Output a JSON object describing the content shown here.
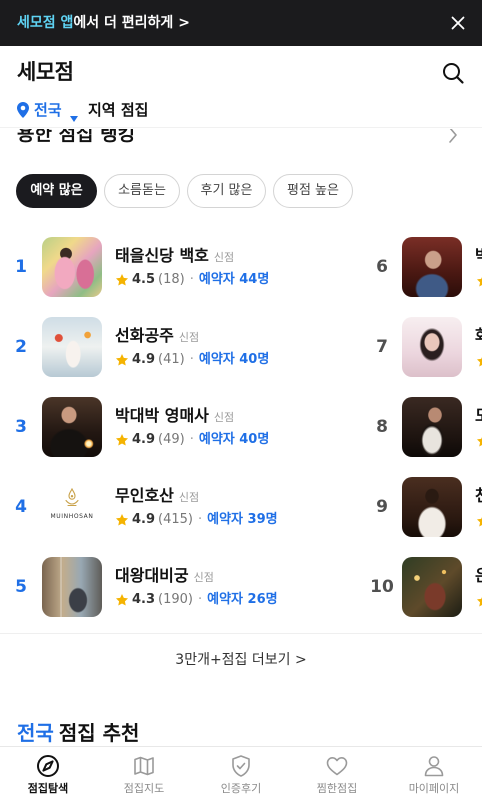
{
  "colors": {
    "accent": "#1f6fe6",
    "star": "#f5b301",
    "banner_bg": "#1b1b1d",
    "banner_highlight": "#5fd3f3",
    "rank_secondary": "#505050",
    "chip_selected_bg": "#1b1b1f"
  },
  "banner": {
    "highlight": "세모점 앱",
    "text": "에서 더 편리하게 >",
    "close_icon": "close-icon"
  },
  "header": {
    "title": "세모점",
    "search_icon": "search-icon"
  },
  "location": {
    "pin_icon": "location-pin-icon",
    "region": "전국",
    "dropdown_icon": "dropdown-triangle-icon",
    "suffix": "지역 점집"
  },
  "ranking": {
    "title": "용한 점집 랭킹",
    "chevron_icon": "chevron-right-icon",
    "filters": [
      {
        "label": "예약 많은",
        "selected": true
      },
      {
        "label": "소름돋는",
        "selected": false
      },
      {
        "label": "후기 많은",
        "selected": false
      },
      {
        "label": "평점 높은",
        "selected": false
      }
    ],
    "separator": "·",
    "items": [
      {
        "rank": "1",
        "name": "태을신당 백호",
        "tag": "신점",
        "rating": "4.5",
        "reviews": "(18)",
        "bookings": "예약자 44명"
      },
      {
        "rank": "2",
        "name": "선화공주",
        "tag": "신점",
        "rating": "4.9",
        "reviews": "(41)",
        "bookings": "예약자 40명"
      },
      {
        "rank": "3",
        "name": "박대박 영매사",
        "tag": "신점",
        "rating": "4.9",
        "reviews": "(49)",
        "bookings": "예약자 40명"
      },
      {
        "rank": "4",
        "name": "무인호산",
        "tag": "신점",
        "rating": "4.9",
        "reviews": "(415)",
        "bookings": "예약자 39명",
        "logo_text": "MUINHOSAN"
      },
      {
        "rank": "5",
        "name": "대왕대비궁",
        "tag": "신점",
        "rating": "4.3",
        "reviews": "(190)",
        "bookings": "예약자 26명"
      }
    ],
    "more_items": [
      {
        "rank": "6",
        "name": "박"
      },
      {
        "rank": "7",
        "name": "화"
      },
      {
        "rank": "8",
        "name": "도"
      },
      {
        "rank": "9",
        "name": "천"
      },
      {
        "rank": "10",
        "name": "은"
      }
    ],
    "more_link": "3만개+점집 더보기 >"
  },
  "recommend": {
    "highlight": "전국",
    "title": "점집 추천"
  },
  "bottom_nav": [
    {
      "label": "점집탐색",
      "icon": "compass-icon",
      "active": true
    },
    {
      "label": "점집지도",
      "icon": "map-icon",
      "active": false
    },
    {
      "label": "인증후기",
      "icon": "shield-check-icon",
      "active": false
    },
    {
      "label": "찜한점집",
      "icon": "heart-icon",
      "active": false
    },
    {
      "label": "마이페이지",
      "icon": "person-icon",
      "active": false
    }
  ]
}
